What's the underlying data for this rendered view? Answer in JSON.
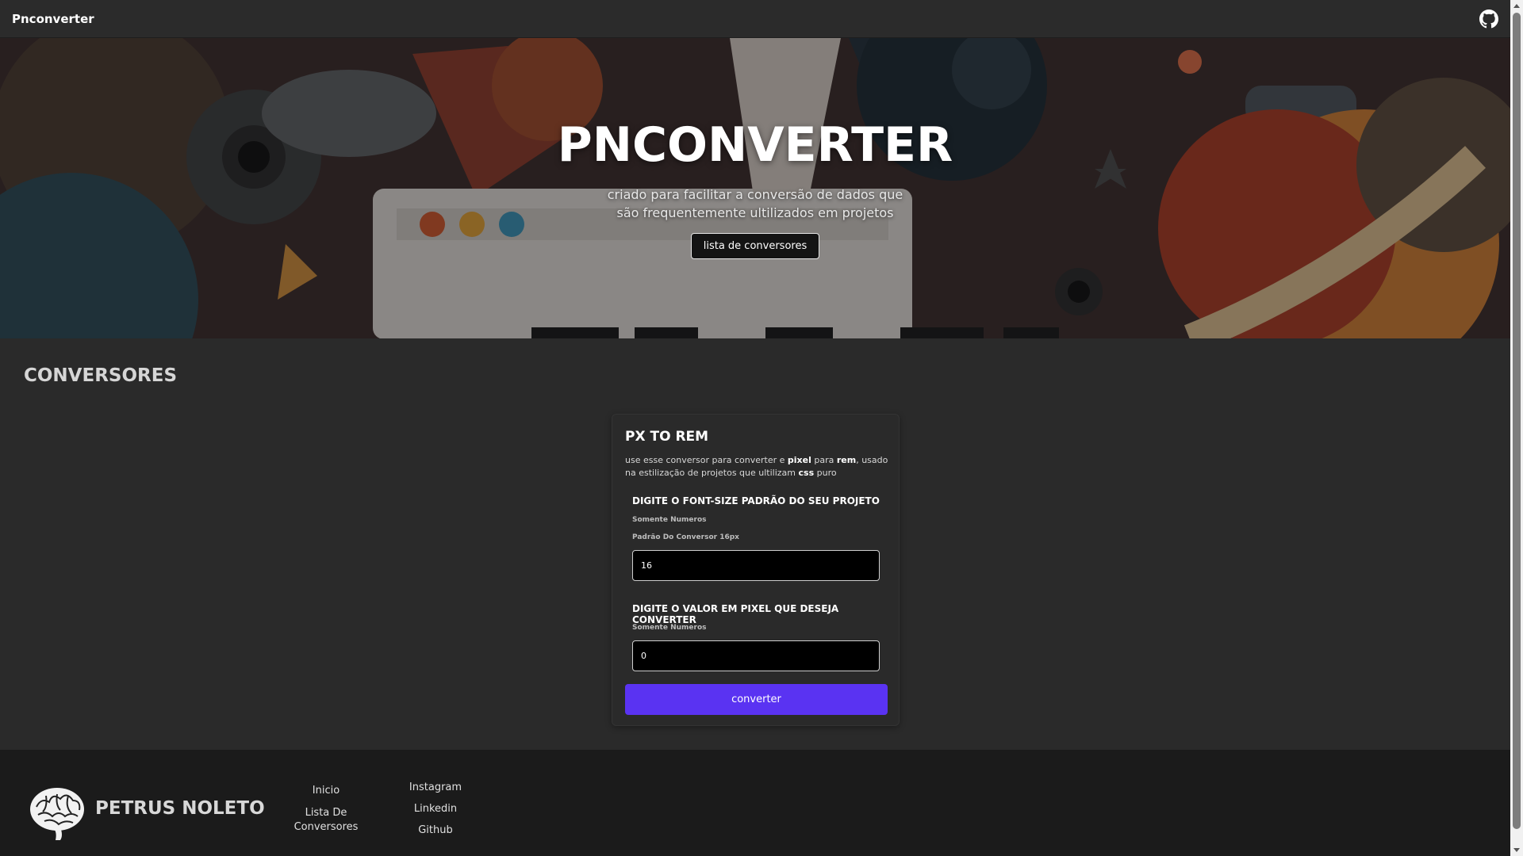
{
  "topbar": {
    "brand": "Pnconverter",
    "github_icon": "github-icon"
  },
  "hero": {
    "title": "PNCONVERTER",
    "subtitle": "criado para facilitar a conversão de dados que são frequentemente ultilizados em projetos",
    "button_label": "lista de conversores"
  },
  "section": {
    "title": "CONVERSORES"
  },
  "card": {
    "title": "PX TO REM",
    "desc_1": "use esse conversor para converter e ",
    "desc_pixel": "pixel",
    "desc_2": " para ",
    "desc_rem": "rem",
    "desc_3": ", usado na estilização de projetos que ultilizam ",
    "desc_css": "css",
    "desc_4": " puro",
    "field1": {
      "label": "DIGITE O FONT-SIZE PADRÃO DO SEU PROJETO",
      "hint1": "Somente Numeros",
      "hint2": "Padrão Do Conversor 16px",
      "value": "16"
    },
    "field2": {
      "label": "DIGITE O VALOR EM PIXEL QUE DESEJA CONVERTER",
      "hint1": "Somente Numeros",
      "value": "0"
    },
    "button_label": "converter",
    "button_color": "#5a33f2"
  },
  "footer": {
    "name": "PETRUS NOLETO",
    "logo_icon": "brain-icon",
    "nav": {
      "home": "Inicio",
      "list": "Lista De Conversores"
    },
    "social": {
      "instagram": "Instagram",
      "linkedin": "Linkedin",
      "github": "Github"
    }
  }
}
